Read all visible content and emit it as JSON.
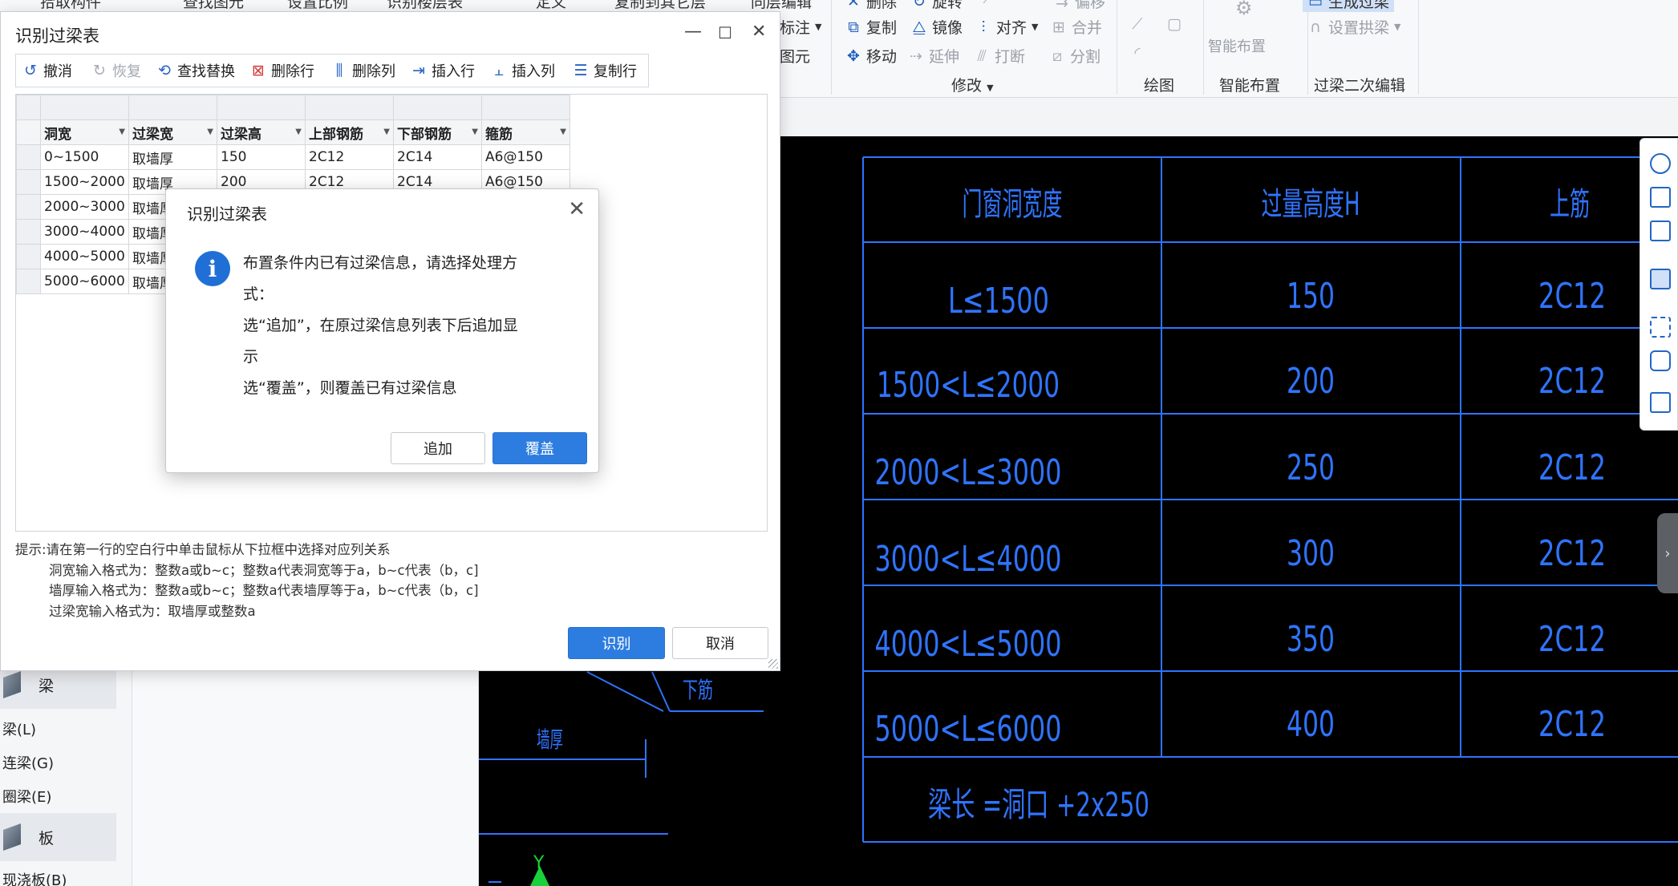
{
  "ribbon": {
    "top_cut": [
      "拾取构件",
      "查找图元",
      "设置比例",
      "识别楼层表",
      "定义",
      "复制到其它层",
      "同层编辑"
    ],
    "tools": {
      "label_note": "标注",
      "element": "图元",
      "copy": "复制",
      "mirror": "镜像",
      "align": "对齐",
      "merge": "合并",
      "move": "移动",
      "extend": "延伸",
      "break": "打断",
      "split": "分割",
      "delete": "删除",
      "rotate": "旋转",
      "offset": "偏移",
      "smart_place": "智能布置",
      "generate_lintel": "生成过梁",
      "set_arch": "设置拱梁"
    },
    "groups": {
      "modify": "修改",
      "draw": "绘图",
      "smart": "智能布置",
      "lintel_edit": "过梁二次编辑"
    }
  },
  "nav": {
    "cat_beam": "梁",
    "beam_items": [
      "梁(L)",
      "连梁(G)",
      "圈梁(E)"
    ],
    "cat_slab": "板",
    "slab_items": [
      "现浇板(B)"
    ]
  },
  "dialog": {
    "title": "识别过梁表",
    "toolbar": {
      "undo": "撤消",
      "redo": "恢复",
      "find_replace": "查找替换",
      "delete_row": "删除行",
      "delete_col": "删除列",
      "insert_row": "插入行",
      "insert_col": "插入列",
      "copy_row": "复制行"
    },
    "columns": [
      "洞宽",
      "过梁宽",
      "过梁高",
      "上部钢筋",
      "下部钢筋",
      "箍筋"
    ],
    "rows": [
      [
        "0~1500",
        "取墙厚",
        "150",
        "2C12",
        "2C14",
        "A6@150"
      ],
      [
        "1500~2000",
        "取墙厚",
        "200",
        "2C12",
        "2C14",
        "A6@150"
      ],
      [
        "2000~3000",
        "取墙厚",
        "",
        "",
        "",
        ""
      ],
      [
        "3000~4000",
        "取墙厚",
        "",
        "",
        "",
        ""
      ],
      [
        "4000~5000",
        "取墙厚",
        "",
        "",
        "",
        ""
      ],
      [
        "5000~6000",
        "取墙厚",
        "",
        "",
        "",
        ""
      ]
    ],
    "hints": [
      "提示:请在第一行的空白行中单击鼠标从下拉框中选择对应列关系",
      "洞宽输入格式为：整数a或b~c；整数a代表洞宽等于a，b~c代表（b，c]",
      "墙厚输入格式为：整数a或b~c；整数a代表墙厚等于a，b~c代表（b，c]",
      "过梁宽输入格式为：取墙厚或整数a"
    ],
    "recognize": "识别",
    "cancel": "取消"
  },
  "modal": {
    "title": "识别过梁表",
    "lines": [
      "布置条件内已有过梁信息，请选择处理方",
      "式：",
      "选“追加”，在原过梁信息列表下后追加显",
      "示",
      "选“覆盖”，则覆盖已有过梁信息"
    ],
    "append": "追加",
    "overwrite": "覆盖"
  },
  "cad": {
    "headers": [
      "门窗洞宽度",
      "过量高度H",
      "上筋"
    ],
    "rows": [
      [
        "L≤1500",
        "150",
        "2C12"
      ],
      [
        "1500<L≤2000",
        "200",
        "2C12"
      ],
      [
        "2000<L≤3000",
        "250",
        "2C12"
      ],
      [
        "3000<L≤4000",
        "300",
        "2C12"
      ],
      [
        "4000<L≤5000",
        "350",
        "2C12"
      ],
      [
        "5000<L≤6000",
        "400",
        "2C12"
      ]
    ],
    "formula": "梁长 =洞口 +2x250",
    "label_bottom_bar": "下筋",
    "label_wall": "墙厚",
    "axis_y": "Y"
  }
}
